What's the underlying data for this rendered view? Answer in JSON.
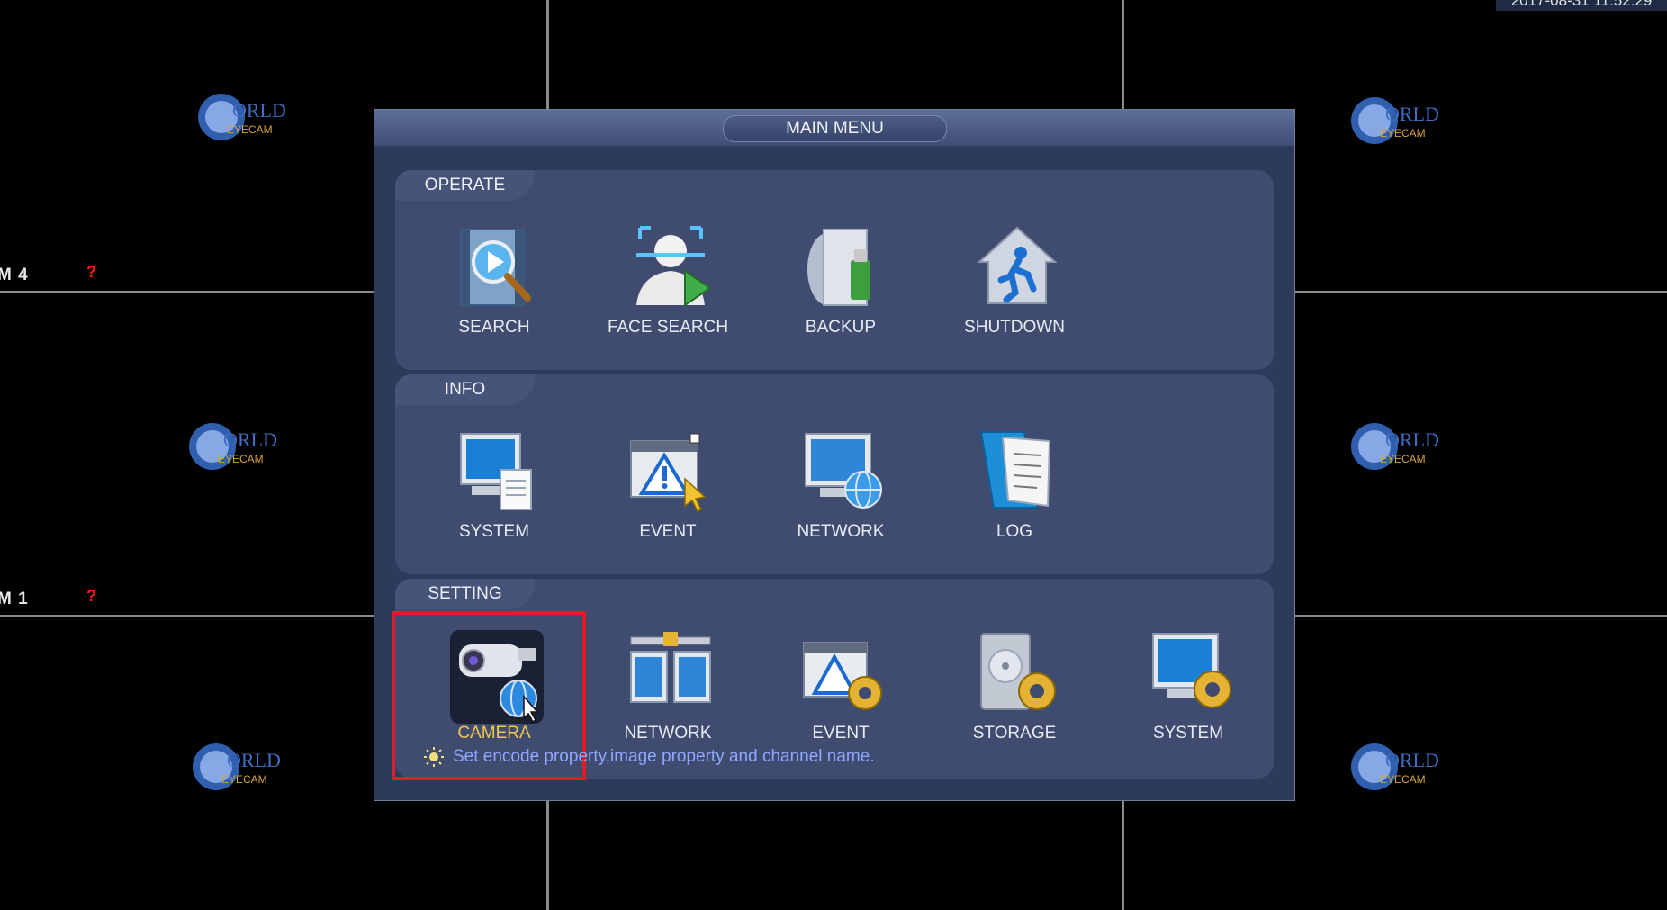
{
  "clock": "2017-08-31 11:52:29",
  "cameras": [
    {
      "label": "M 4",
      "status": "?"
    },
    {
      "label": "M 1",
      "status": "?"
    }
  ],
  "logo_text": [
    "WORLD",
    "EYECAM"
  ],
  "menu": {
    "title": "MAIN MENU",
    "sections": [
      {
        "title": "OPERATE",
        "items": [
          {
            "label": "SEARCH",
            "icon": "video-search-icon"
          },
          {
            "label": "FACE SEARCH",
            "icon": "face-search-icon"
          },
          {
            "label": "BACKUP",
            "icon": "usb-backup-icon"
          },
          {
            "label": "SHUTDOWN",
            "icon": "shutdown-house-icon"
          }
        ]
      },
      {
        "title": "INFO",
        "items": [
          {
            "label": "SYSTEM",
            "icon": "monitor-doc-icon"
          },
          {
            "label": "EVENT",
            "icon": "warning-window-icon"
          },
          {
            "label": "NETWORK",
            "icon": "monitor-globe-icon"
          },
          {
            "label": "LOG",
            "icon": "log-book-icon"
          }
        ]
      },
      {
        "title": "SETTING",
        "items": [
          {
            "label": "CAMERA",
            "icon": "camera-globe-icon",
            "selected": true
          },
          {
            "label": "NETWORK",
            "icon": "network-monitors-icon"
          },
          {
            "label": "EVENT",
            "icon": "warning-gear-icon"
          },
          {
            "label": "STORAGE",
            "icon": "hdd-gear-icon"
          },
          {
            "label": "SYSTEM",
            "icon": "monitor-gear-icon"
          }
        ]
      }
    ],
    "hint": "Set encode property,image property and channel name."
  },
  "colors": {
    "accent_selected": "#f5c64a",
    "highlight_border": "#e01c28",
    "hint_text": "#8ea7ff"
  }
}
